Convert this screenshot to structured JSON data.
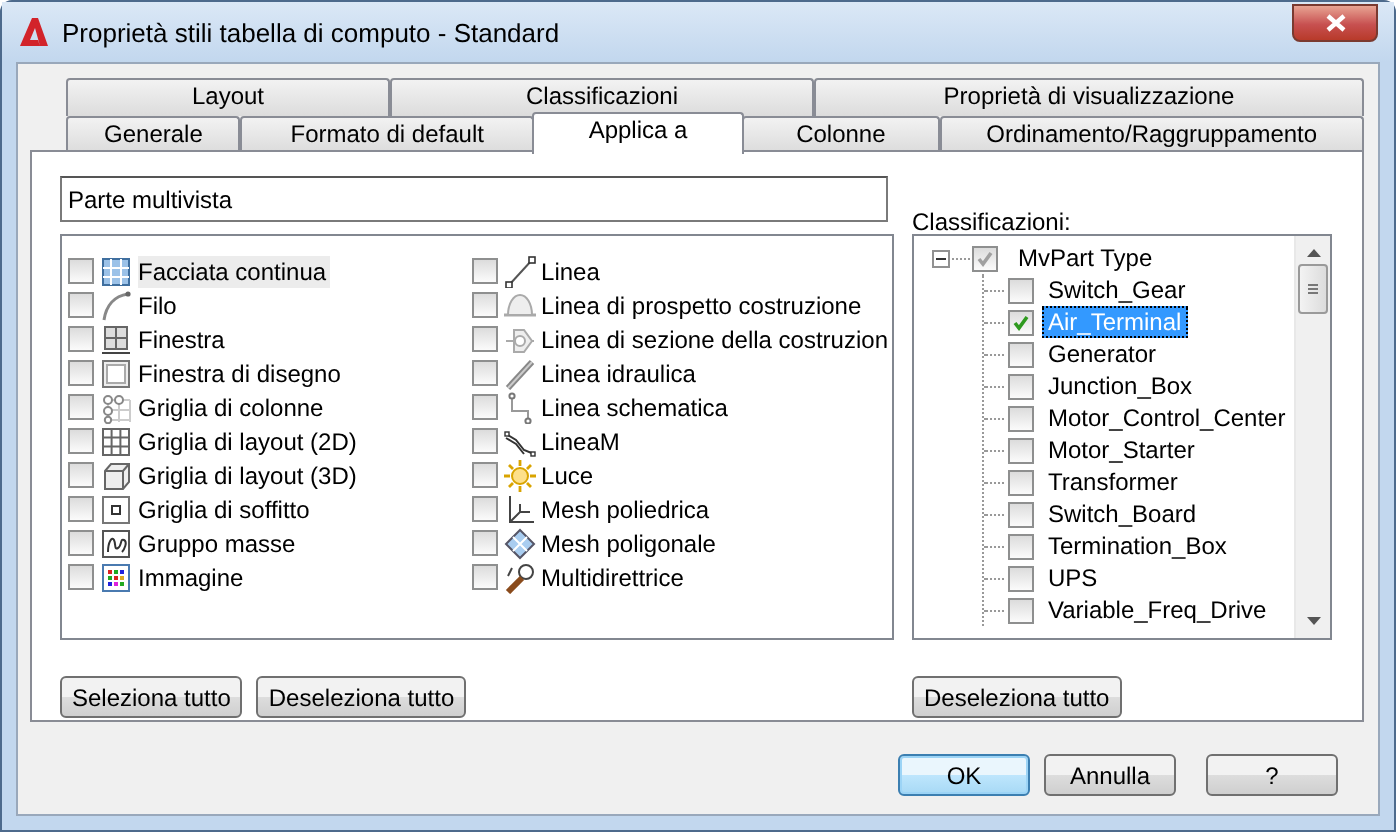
{
  "window": {
    "title": "Proprietà stili tabella di computo - Standard"
  },
  "tab_rows": [
    {
      "tabs": [
        {
          "label": "Layout",
          "selected": false
        },
        {
          "label": "Classificazioni",
          "selected": false
        },
        {
          "label": "Proprietà di visualizzazione",
          "selected": false
        }
      ]
    },
    {
      "tabs": [
        {
          "label": "Generale",
          "selected": false
        },
        {
          "label": "Formato di default",
          "selected": false
        },
        {
          "label": "Applica a",
          "selected": true
        },
        {
          "label": "Colonne",
          "selected": false
        },
        {
          "label": "Ordinamento/Raggruppamento",
          "selected": false
        }
      ]
    }
  ],
  "name_field": {
    "value": "Parte multivista"
  },
  "object_list": {
    "columns": [
      {
        "items": [
          {
            "label": "Facciata continua",
            "checked": false,
            "selected": true
          },
          {
            "label": "Filo",
            "checked": false,
            "selected": false
          },
          {
            "label": "Finestra",
            "checked": false,
            "selected": false
          },
          {
            "label": "Finestra di disegno",
            "checked": false,
            "selected": false
          },
          {
            "label": "Griglia di colonne",
            "checked": false,
            "selected": false
          },
          {
            "label": "Griglia di layout (2D)",
            "checked": false,
            "selected": false
          },
          {
            "label": "Griglia di layout (3D)",
            "checked": false,
            "selected": false
          },
          {
            "label": "Griglia di soffitto",
            "checked": false,
            "selected": false
          },
          {
            "label": "Gruppo masse",
            "checked": false,
            "selected": false
          },
          {
            "label": "Immagine",
            "checked": false,
            "selected": false
          }
        ]
      },
      {
        "items": [
          {
            "label": "Linea",
            "checked": false,
            "selected": false
          },
          {
            "label": "Linea di prospetto costruzione",
            "checked": false,
            "selected": false
          },
          {
            "label": "Linea di sezione della costruzion",
            "checked": false,
            "selected": false
          },
          {
            "label": "Linea idraulica",
            "checked": false,
            "selected": false
          },
          {
            "label": "Linea schematica",
            "checked": false,
            "selected": false
          },
          {
            "label": "LineaM",
            "checked": false,
            "selected": false
          },
          {
            "label": "Luce",
            "checked": false,
            "selected": false
          },
          {
            "label": "Mesh poliedrica",
            "checked": false,
            "selected": false
          },
          {
            "label": "Mesh poligonale",
            "checked": false,
            "selected": false
          },
          {
            "label": "Multidirettrice",
            "checked": false,
            "selected": false
          }
        ]
      }
    ]
  },
  "classifications": {
    "label": "Classificazioni:",
    "tree": {
      "label": "MvPart Type",
      "checked": true,
      "expanded": true,
      "children": [
        {
          "label": "Switch_Gear",
          "checked": false,
          "selected": false
        },
        {
          "label": "Air_Terminal",
          "checked": true,
          "selected": true
        },
        {
          "label": "Generator",
          "checked": false,
          "selected": false
        },
        {
          "label": "Junction_Box",
          "checked": false,
          "selected": false
        },
        {
          "label": "Motor_Control_Center",
          "checked": false,
          "selected": false
        },
        {
          "label": "Motor_Starter",
          "checked": false,
          "selected": false
        },
        {
          "label": "Transformer",
          "checked": false,
          "selected": false
        },
        {
          "label": "Switch_Board",
          "checked": false,
          "selected": false
        },
        {
          "label": "Termination_Box",
          "checked": false,
          "selected": false
        },
        {
          "label": "UPS",
          "checked": false,
          "selected": false
        },
        {
          "label": "Variable_Freq_Drive",
          "checked": false,
          "selected": false
        }
      ]
    }
  },
  "list_buttons": [
    "Seleziona tutto",
    "Deseleziona tutto"
  ],
  "tree_buttons": [
    "Deseleziona tutto"
  ],
  "dialog_buttons": [
    {
      "label": "OK",
      "default": true
    },
    {
      "label": "Annulla",
      "default": false
    },
    {
      "label": "?",
      "default": false
    }
  ]
}
